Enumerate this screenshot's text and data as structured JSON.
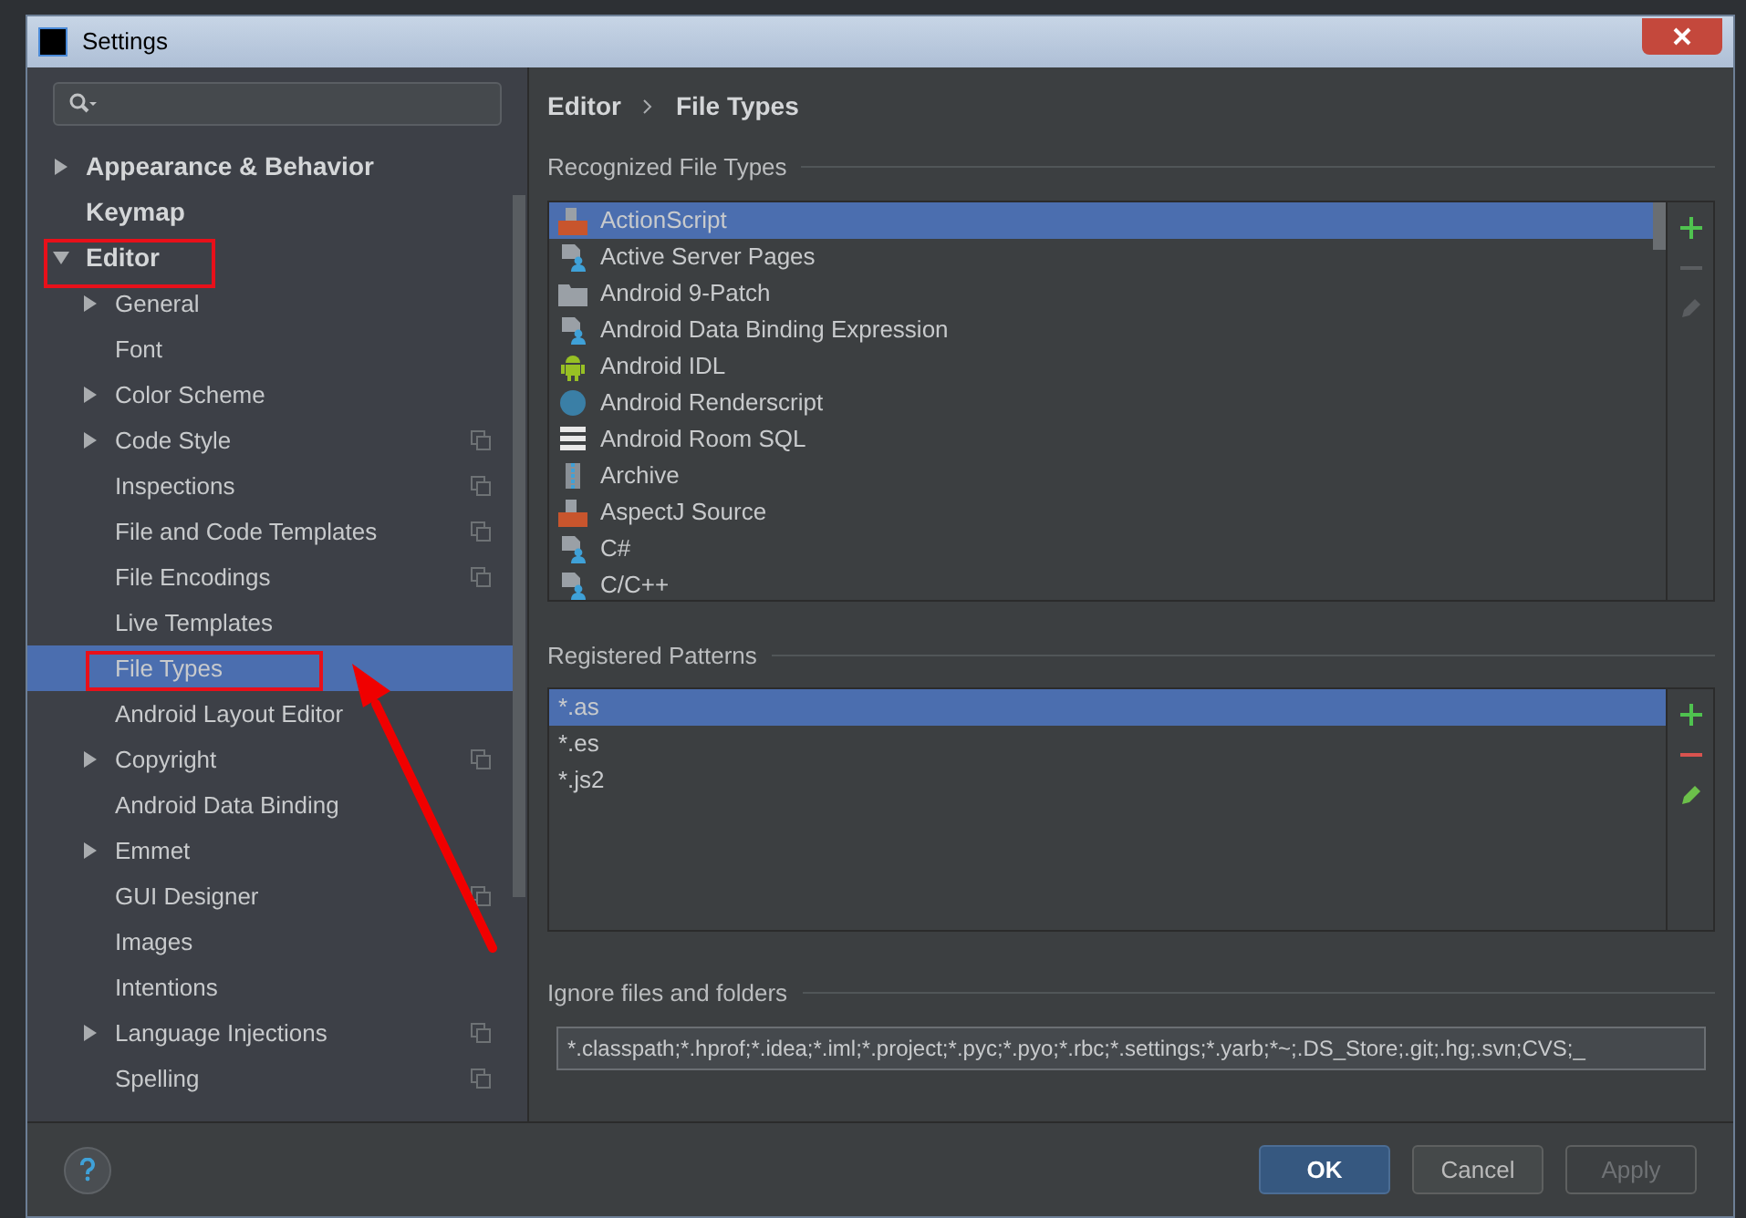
{
  "window": {
    "title": "Settings"
  },
  "sidebar": {
    "items": [
      {
        "label": "Appearance & Behavior",
        "expanded": false,
        "selected": false,
        "project_level": false
      },
      {
        "label": "Keymap",
        "selected": false,
        "project_level": false
      },
      {
        "label": "Editor",
        "expanded": true,
        "selected": false,
        "project_level": false,
        "children": [
          {
            "label": "General",
            "expanded": false,
            "selected": false,
            "project_level": false
          },
          {
            "label": "Font",
            "selected": false,
            "project_level": false
          },
          {
            "label": "Color Scheme",
            "expanded": false,
            "selected": false,
            "project_level": false
          },
          {
            "label": "Code Style",
            "expanded": false,
            "selected": false,
            "project_level": true
          },
          {
            "label": "Inspections",
            "selected": false,
            "project_level": true
          },
          {
            "label": "File and Code Templates",
            "selected": false,
            "project_level": true
          },
          {
            "label": "File Encodings",
            "selected": false,
            "project_level": true
          },
          {
            "label": "Live Templates",
            "selected": false,
            "project_level": false
          },
          {
            "label": "File Types",
            "selected": true,
            "project_level": false
          },
          {
            "label": "Android Layout Editor",
            "selected": false,
            "project_level": false
          },
          {
            "label": "Copyright",
            "expanded": false,
            "selected": false,
            "project_level": true
          },
          {
            "label": "Android Data Binding",
            "selected": false,
            "project_level": false
          },
          {
            "label": "Emmet",
            "expanded": false,
            "selected": false,
            "project_level": false
          },
          {
            "label": "GUI Designer",
            "selected": false,
            "project_level": true
          },
          {
            "label": "Images",
            "selected": false,
            "project_level": false
          },
          {
            "label": "Intentions",
            "selected": false,
            "project_level": false
          },
          {
            "label": "Language Injections",
            "expanded": false,
            "selected": false,
            "project_level": true
          },
          {
            "label": "Spelling",
            "selected": false,
            "project_level": true
          }
        ]
      }
    ]
  },
  "breadcrumb": [
    "Editor",
    "File Types"
  ],
  "recognized_file_types": {
    "title": "Recognized File Types",
    "items": [
      {
        "label": "ActionScript",
        "kind": "as",
        "selected": true
      },
      {
        "label": "Active Server Pages",
        "kind": "file",
        "selected": false
      },
      {
        "label": "Android 9-Patch",
        "kind": "folder",
        "selected": false
      },
      {
        "label": "Android Data Binding Expression",
        "kind": "file",
        "selected": false
      },
      {
        "label": "Android IDL",
        "kind": "android",
        "selected": false
      },
      {
        "label": "Android Renderscript",
        "kind": "rs",
        "selected": false
      },
      {
        "label": "Android Room SQL",
        "kind": "sql",
        "selected": false
      },
      {
        "label": "Archive",
        "kind": "archive",
        "selected": false
      },
      {
        "label": "AspectJ Source",
        "kind": "aj",
        "selected": false
      },
      {
        "label": "C#",
        "kind": "file",
        "selected": false
      },
      {
        "label": "C/C++",
        "kind": "file",
        "selected": false
      }
    ],
    "toolbar": {
      "add_disabled": false,
      "remove_disabled": true,
      "edit_disabled": true
    }
  },
  "registered_patterns": {
    "title": "Registered Patterns",
    "items": [
      {
        "label": "*.as",
        "selected": true
      },
      {
        "label": "*.es",
        "selected": false
      },
      {
        "label": "*.js2",
        "selected": false
      }
    ],
    "toolbar": {
      "add_disabled": false,
      "remove_disabled": false,
      "edit_disabled": false
    }
  },
  "ignore": {
    "title": "Ignore files and folders",
    "value": "*.classpath;*.hprof;*.idea;*.iml;*.project;*.pyc;*.pyo;*.rbc;*.settings;*.yarb;*~;.DS_Store;.git;.hg;.svn;CVS;_"
  },
  "buttons": [
    {
      "label": "OK",
      "kind": "default",
      "disabled": false
    },
    {
      "label": "Cancel",
      "kind": "normal",
      "disabled": false
    },
    {
      "label": "Apply",
      "kind": "normal",
      "disabled": true
    }
  ]
}
